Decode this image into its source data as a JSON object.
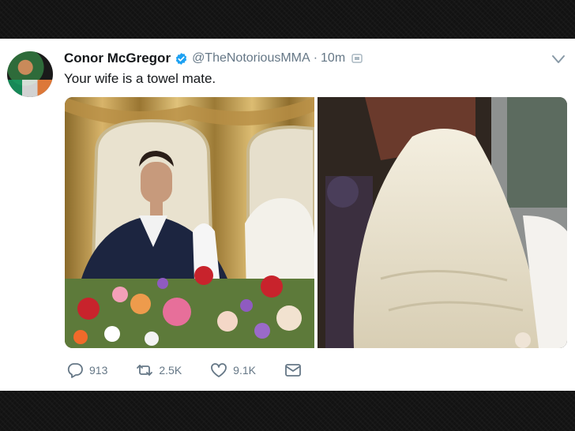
{
  "tweet": {
    "author_name": "Conor McGregor",
    "handle": "@TheNotoriousMMA",
    "separator": "·",
    "time": "10m",
    "text": "Your wife is a towel mate.",
    "verified": true
  },
  "icons": {
    "verified": "verified-badge-icon",
    "lock": "protected-lock-icon",
    "caret": "chevron-down-icon",
    "reply": "reply-icon",
    "retweet": "retweet-icon",
    "like": "heart-icon",
    "dm": "envelope-icon"
  },
  "actions": {
    "replies": "913",
    "retweets": "2.5K",
    "likes": "9.1K"
  },
  "colors": {
    "verified": "#1da1f2",
    "secondary_text": "#657786",
    "primary_text": "#14171a",
    "card_bg": "#ffffff"
  }
}
